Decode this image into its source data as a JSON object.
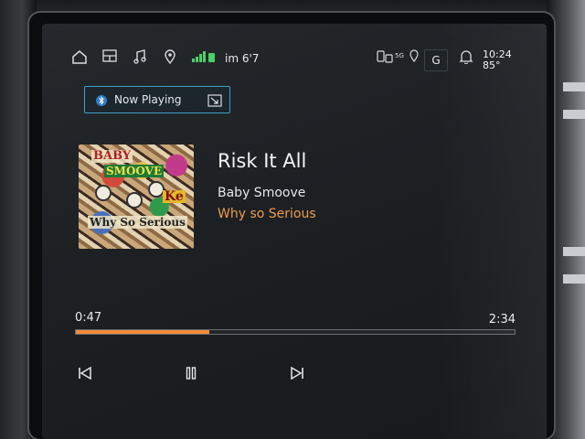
{
  "status_bar": {
    "signal_text": "im 6'7",
    "network_5g": "5G",
    "profile_initial": "G",
    "time": "10:24",
    "temperature": "85°"
  },
  "now_playing_tab": {
    "label": "Now Playing",
    "source_icon": "bluetooth-icon"
  },
  "track": {
    "title": "Risk It All",
    "artist": "Baby Smoove",
    "album": "Why so Serious"
  },
  "album_art": {
    "text_1": "BABY",
    "text_2": "SMOOVE",
    "text_3": "Why So Serious",
    "text_4": "Ke"
  },
  "playback": {
    "elapsed": "0:47",
    "total": "2:34",
    "progress_fraction": 0.305
  },
  "colors": {
    "accent_orange": "#f08a3a",
    "now_playing_border": "#3fa0c8",
    "screen_bg": "#1c2023"
  }
}
